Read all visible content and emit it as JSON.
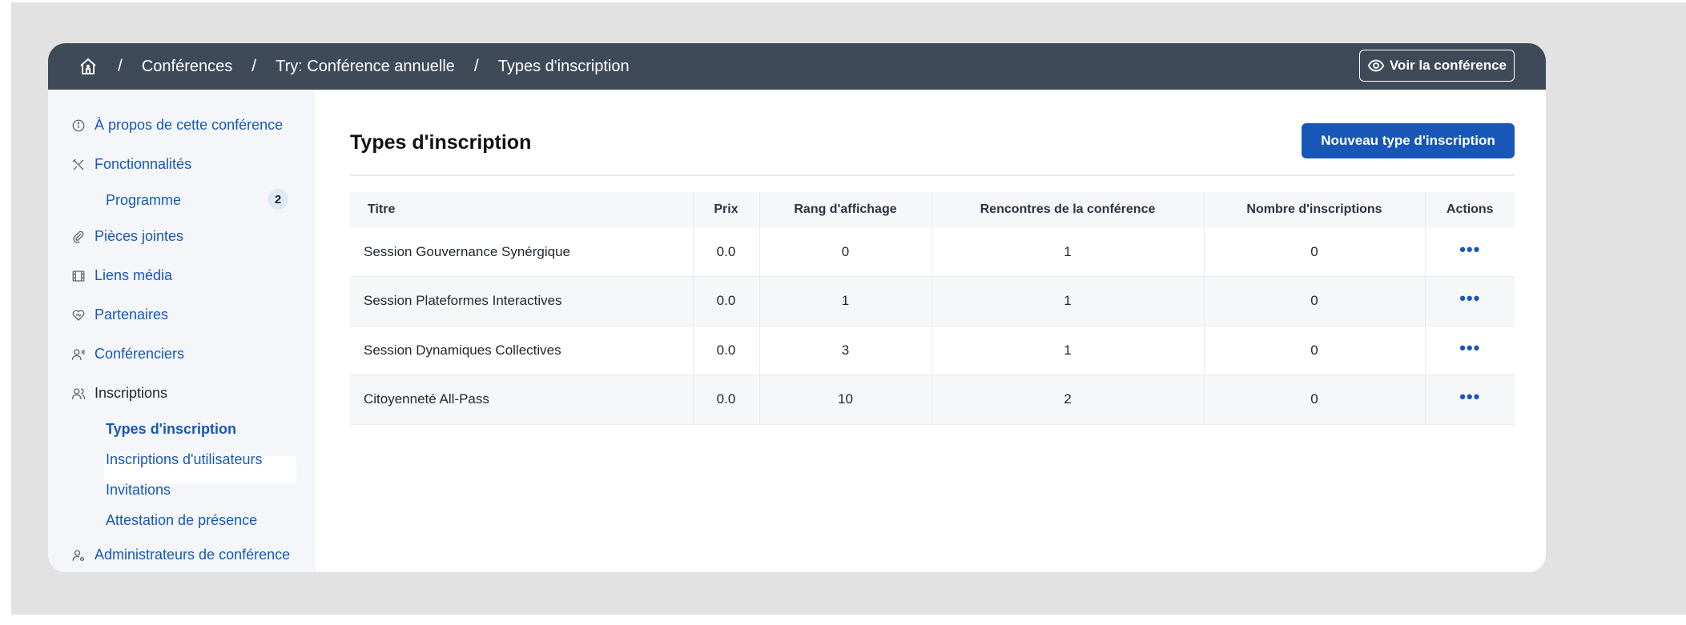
{
  "breadcrumb": {
    "home_icon": "home-icon",
    "items": [
      "Conférences",
      "Try: Conférence annuelle",
      "Types d'inscription"
    ],
    "separator": "/"
  },
  "header": {
    "view_button_label": "Voir la conférence",
    "view_icon": "eye-icon"
  },
  "sidebar": {
    "items": [
      {
        "label": "À propos de cette conférence",
        "icon": "info-icon"
      },
      {
        "label": "Fonctionnalités",
        "icon": "tools-icon"
      },
      {
        "label": "Programme",
        "badge": "2"
      },
      {
        "label": "Pièces jointes",
        "icon": "paperclip-icon"
      },
      {
        "label": "Liens média",
        "icon": "film-icon"
      },
      {
        "label": "Partenaires",
        "icon": "handshake-heart-icon"
      },
      {
        "label": "Conférenciers",
        "icon": "speaker-icon"
      },
      {
        "label": "Inscriptions",
        "icon": "users-icon"
      },
      {
        "label": "Types d'inscription"
      },
      {
        "label": "Inscriptions d'utilisateurs"
      },
      {
        "label": "Invitations"
      },
      {
        "label": "Attestation de présence"
      },
      {
        "label": "Administrateurs de conférence",
        "icon": "user-gear-icon"
      }
    ]
  },
  "main": {
    "title": "Types d'inscription",
    "new_button_label": "Nouveau type d'inscription",
    "table": {
      "headers": [
        "Titre",
        "Prix",
        "Rang d'affichage",
        "Rencontres de la conférence",
        "Nombre d'inscriptions",
        "Actions"
      ],
      "rows": [
        [
          "Session Gouvernance Synérgique",
          "0.0",
          "0",
          "1",
          "0",
          "•••"
        ],
        [
          "Session Plateformes Interactives",
          "0.0",
          "1",
          "1",
          "0",
          "•••"
        ],
        [
          "Session Dynamiques Collectives",
          "0.0",
          "3",
          "1",
          "0",
          "•••"
        ],
        [
          "Citoyenneté All-Pass",
          "0.0",
          "10",
          "2",
          "0",
          "•••"
        ]
      ]
    }
  },
  "colors": {
    "header_bg": "#3f4a59",
    "accent": "#1857b8",
    "sidebar_bg": "#f4f6f9"
  }
}
